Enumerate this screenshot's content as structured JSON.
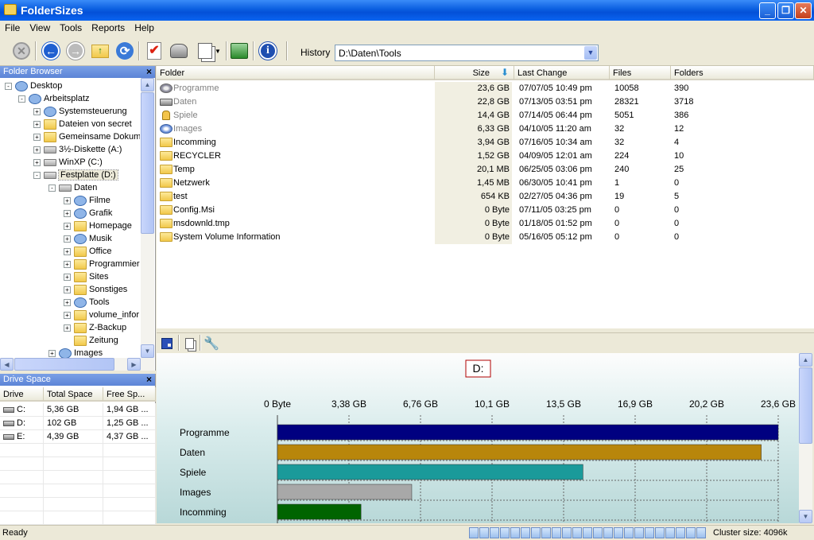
{
  "window": {
    "title": "FolderSizes"
  },
  "menu": [
    "File",
    "View",
    "Tools",
    "Reports",
    "Help"
  ],
  "history": {
    "label": "History",
    "value": "D:\\Daten\\Tools"
  },
  "folder_browser": {
    "title": "Folder Browser",
    "nodes": [
      {
        "label": "Desktop",
        "level": 0,
        "expander": "-",
        "icon": "desktop-icon"
      },
      {
        "label": "Arbeitsplatz",
        "level": 1,
        "expander": "-",
        "icon": "computer-icon"
      },
      {
        "label": "Systemsteuerung",
        "level": 2,
        "expander": "+",
        "icon": "control-panel-icon"
      },
      {
        "label": "Dateien von secret",
        "level": 2,
        "expander": "+",
        "icon": "folder-icon"
      },
      {
        "label": "Gemeinsame Dokume",
        "level": 2,
        "expander": "+",
        "icon": "shared-folder-icon"
      },
      {
        "label": "3½-Diskette (A:)",
        "level": 2,
        "expander": "+",
        "icon": "floppy-icon"
      },
      {
        "label": "WinXP (C:)",
        "level": 2,
        "expander": "+",
        "icon": "drive-icon"
      },
      {
        "label": "Festplatte (D:)",
        "level": 2,
        "expander": "-",
        "icon": "drive-icon",
        "selected": true
      },
      {
        "label": "Daten",
        "level": 3,
        "expander": "-",
        "icon": "drive-icon"
      },
      {
        "label": "Filme",
        "level": 4,
        "expander": "+",
        "icon": "media-folder-icon"
      },
      {
        "label": "Grafik",
        "level": 4,
        "expander": "+",
        "icon": "paint-folder-icon"
      },
      {
        "label": "Homepage",
        "level": 4,
        "expander": "+",
        "icon": "folder-icon"
      },
      {
        "label": "Musik",
        "level": 4,
        "expander": "+",
        "icon": "music-folder-icon"
      },
      {
        "label": "Office",
        "level": 4,
        "expander": "+",
        "icon": "folder-icon"
      },
      {
        "label": "Programmier",
        "level": 4,
        "expander": "+",
        "icon": "folder-icon"
      },
      {
        "label": "Sites",
        "level": 4,
        "expander": "+",
        "icon": "folder-icon"
      },
      {
        "label": "Sonstiges",
        "level": 4,
        "expander": "+",
        "icon": "folder-icon"
      },
      {
        "label": "Tools",
        "level": 4,
        "expander": "+",
        "icon": "tools-folder-icon"
      },
      {
        "label": "volume_infor",
        "level": 4,
        "expander": "+",
        "icon": "folder-icon"
      },
      {
        "label": "Z-Backup",
        "level": 4,
        "expander": "+",
        "icon": "folder-icon"
      },
      {
        "label": "Zeitung",
        "level": 4,
        "expander": "",
        "icon": "folder-icon"
      },
      {
        "label": "Images",
        "level": 3,
        "expander": "+",
        "icon": "disc-icon"
      }
    ]
  },
  "drive_space": {
    "title": "Drive Space",
    "columns": [
      "Drive",
      "Total Space",
      "Free Sp..."
    ],
    "rows": [
      {
        "drive": "C:",
        "total": "5,36 GB",
        "free": "1,94 GB ..."
      },
      {
        "drive": "D:",
        "total": "102 GB",
        "free": "1,25 GB ..."
      },
      {
        "drive": "E:",
        "total": "4,39 GB",
        "free": "4,37 GB ..."
      }
    ]
  },
  "file_list": {
    "columns": [
      "Folder",
      "Size",
      "Last Change",
      "Files",
      "Folders"
    ],
    "rows": [
      {
        "folder": "Programme",
        "size": "23,6 GB",
        "changed": "07/07/05 10:49 pm",
        "files": "10058",
        "folders": "390",
        "icon": "gear-folder-icon",
        "dim": true
      },
      {
        "folder": "Daten",
        "size": "22,8 GB",
        "changed": "07/13/05 03:51 pm",
        "files": "28321",
        "folders": "3718",
        "icon": "drive-icon",
        "dim": true
      },
      {
        "folder": "Spiele",
        "size": "14,4 GB",
        "changed": "07/14/05 06:44 pm",
        "files": "5051",
        "folders": "386",
        "icon": "lock-folder-icon",
        "dim": true
      },
      {
        "folder": "Images",
        "size": "6,33 GB",
        "changed": "04/10/05 11:20 am",
        "files": "32",
        "folders": "12",
        "icon": "disc-icon",
        "dim": true
      },
      {
        "folder": "Incomming",
        "size": "3,94 GB",
        "changed": "07/16/05 10:34 am",
        "files": "32",
        "folders": "4",
        "icon": "folder-icon"
      },
      {
        "folder": "RECYCLER",
        "size": "1,52 GB",
        "changed": "04/09/05 12:01 am",
        "files": "224",
        "folders": "10",
        "icon": "folder-icon"
      },
      {
        "folder": "Temp",
        "size": "20,1 MB",
        "changed": "06/25/05 03:06 pm",
        "files": "240",
        "folders": "25",
        "icon": "folder-icon"
      },
      {
        "folder": "Netzwerk",
        "size": "1,45 MB",
        "changed": "06/30/05 10:41 pm",
        "files": "1",
        "folders": "0",
        "icon": "folder-icon"
      },
      {
        "folder": "test",
        "size": "654 KB",
        "changed": "02/27/05 04:36 pm",
        "files": "19",
        "folders": "5",
        "icon": "folder-icon"
      },
      {
        "folder": "Config.Msi",
        "size": "0 Byte",
        "changed": "07/11/05 03:25 pm",
        "files": "0",
        "folders": "0",
        "icon": "folder-icon"
      },
      {
        "folder": "msdownld.tmp",
        "size": "0 Byte",
        "changed": "01/18/05 01:52 pm",
        "files": "0",
        "folders": "0",
        "icon": "folder-icon"
      },
      {
        "folder": "System Volume Information",
        "size": "0 Byte",
        "changed": "05/16/05 05:12 pm",
        "files": "0",
        "folders": "0",
        "icon": "folder-icon"
      }
    ]
  },
  "chart_data": {
    "type": "bar",
    "orientation": "horizontal",
    "title": "D:",
    "tick_labels": [
      "0 Byte",
      "3,38 GB",
      "6,76 GB",
      "10,1 GB",
      "13,5 GB",
      "16,9 GB",
      "20,2 GB",
      "23,6 GB"
    ],
    "xlim": [
      0,
      23.6
    ],
    "categories": [
      "Programme",
      "Daten",
      "Spiele",
      "Images",
      "Incomming"
    ],
    "values": [
      23.6,
      22.8,
      14.4,
      6.33,
      3.94
    ],
    "colors": [
      "#000080",
      "#b8860b",
      "#1a9a9a",
      "#a8a8a8",
      "#006400"
    ],
    "grid": true
  },
  "status": {
    "left": "Ready",
    "cluster": "Cluster size: 4096k",
    "progress_blocks": 23
  }
}
